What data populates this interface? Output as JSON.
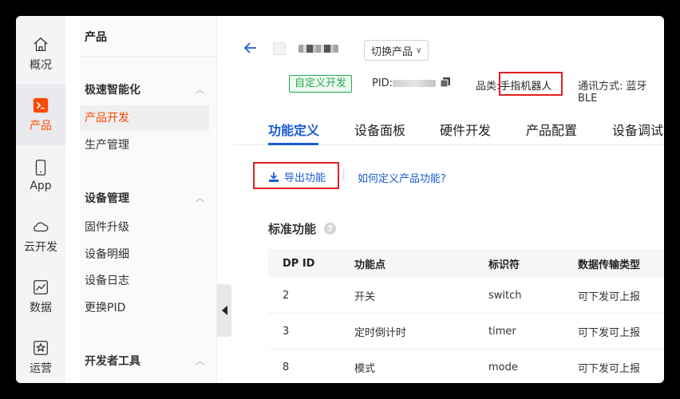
{
  "rail": {
    "items": [
      {
        "label": "概况",
        "icon": "home-icon"
      },
      {
        "label": "产品",
        "icon": "terminal-icon"
      },
      {
        "label": "App",
        "icon": "phone-icon"
      },
      {
        "label": "云开发",
        "icon": "cloud-icon"
      },
      {
        "label": "数据",
        "icon": "chart-icon"
      },
      {
        "label": "运营",
        "icon": "star-icon"
      }
    ],
    "active_color": "#ff4800"
  },
  "menu": {
    "header": "产品",
    "groups": [
      {
        "title": "极速智能化",
        "items": [
          "产品开发",
          "生产管理"
        ]
      },
      {
        "title": "设备管理",
        "items": [
          "固件升级",
          "设备明细",
          "设备日志",
          "更换PID"
        ]
      },
      {
        "title": "开发者工具",
        "items": []
      }
    ],
    "active_item": "产品开发"
  },
  "product": {
    "switch_label": "切换产品",
    "tag": "自定义开发",
    "pid_label": "PID:",
    "category_label": "品类:",
    "category_value": "手指机器人",
    "comm_label": "通讯方式:",
    "comm_value": "蓝牙BLE"
  },
  "tabs": [
    "功能定义",
    "设备面板",
    "硬件开发",
    "产品配置",
    "设备调试"
  ],
  "actions": {
    "export": "导出功能",
    "help": "如何定义产品功能?"
  },
  "section": {
    "title": "标准功能"
  },
  "table": {
    "headers": [
      "DP ID",
      "功能点",
      "标识符",
      "数据传输类型"
    ],
    "rows": [
      [
        "2",
        "开关",
        "switch",
        "可下发可上报"
      ],
      [
        "3",
        "定时倒计时",
        "timer",
        "可下发可上报"
      ],
      [
        "8",
        "模式",
        "mode",
        "可下发可上报"
      ]
    ]
  },
  "colors": {
    "accent": "#1a5bd6",
    "brand": "#ff4800",
    "tag_green": "#23a84e",
    "highlight_red": "#e02020"
  }
}
